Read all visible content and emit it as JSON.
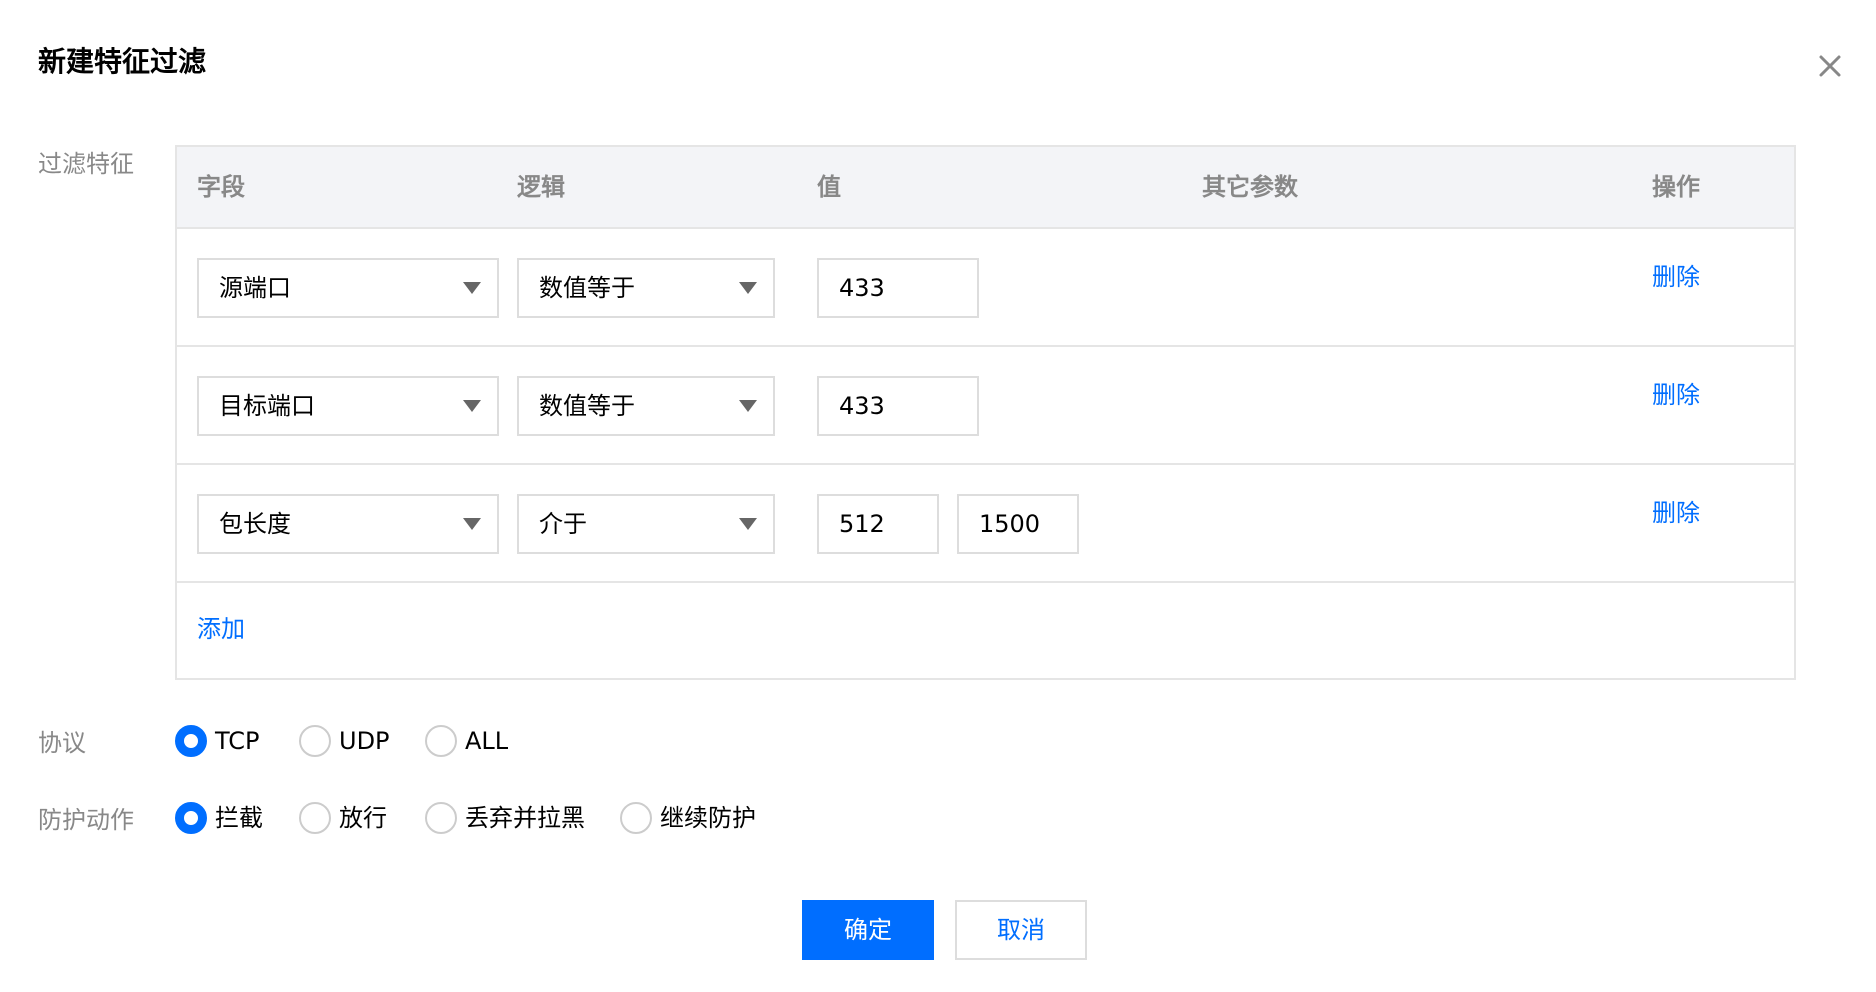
{
  "dialog": {
    "title": "新建特征过滤"
  },
  "filter": {
    "label": "过滤特征",
    "columns": [
      "字段",
      "逻辑",
      "值",
      "其它参数",
      "操作"
    ],
    "rows": [
      {
        "field": "源端口",
        "logic": "数值等于",
        "values": [
          "433"
        ],
        "action": "删除"
      },
      {
        "field": "目标端口",
        "logic": "数值等于",
        "values": [
          "433"
        ],
        "action": "删除"
      },
      {
        "field": "包长度",
        "logic": "介于",
        "values": [
          "512",
          "1500"
        ],
        "action": "删除"
      }
    ],
    "add_label": "添加"
  },
  "protocol": {
    "label": "协议",
    "options": [
      "TCP",
      "UDP",
      "ALL"
    ],
    "selected": "TCP"
  },
  "protection": {
    "label": "防护动作",
    "options": [
      "拦截",
      "放行",
      "丢弃并拉黑",
      "继续防护"
    ],
    "selected": "拦截"
  },
  "footer": {
    "confirm_label": "确定",
    "cancel_label": "取消"
  },
  "colors": {
    "primary": "#006eff",
    "label_gray": "#888888",
    "border": "#e5e5e5",
    "header_bg": "#f3f4f7"
  },
  "icons": {
    "close": "close-icon",
    "dropdown": "caret-down-icon"
  }
}
